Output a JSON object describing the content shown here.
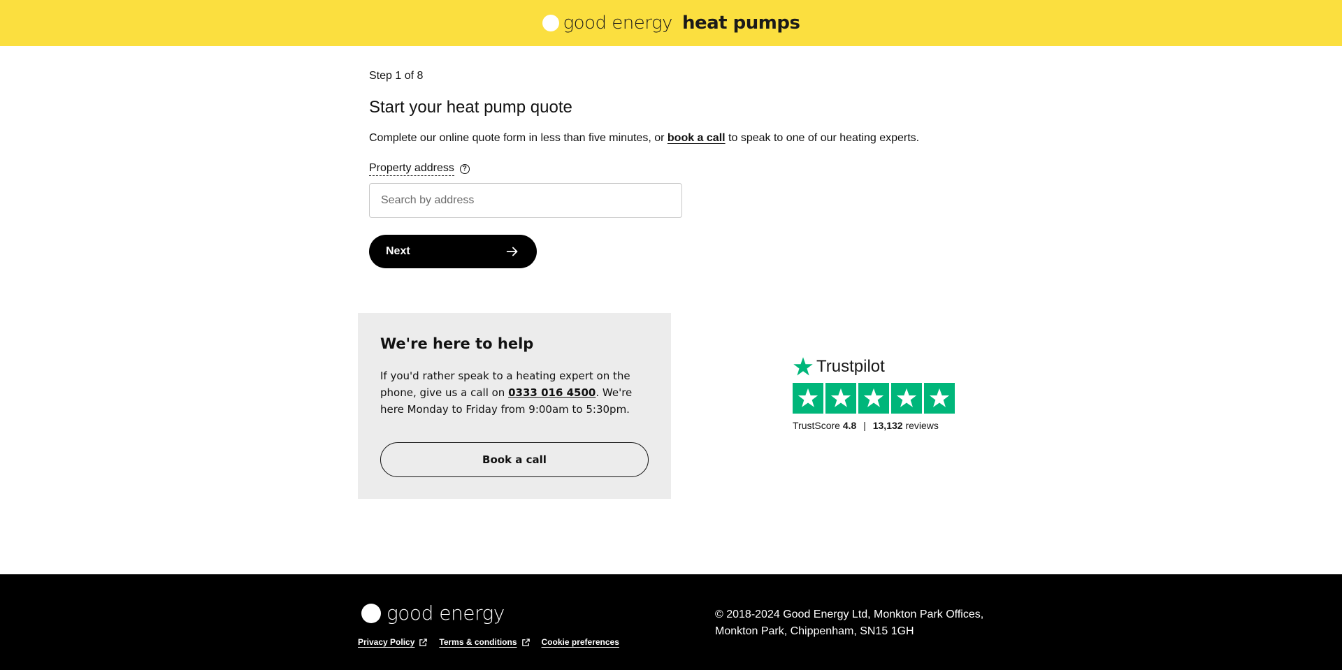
{
  "header": {
    "logo_text_light": "good energy",
    "logo_text_bold": "heat pumps"
  },
  "form": {
    "step": "Step 1 of 8",
    "title": "Start your heat pump quote",
    "intro_before": "Complete our online quote form in less than five minutes, or ",
    "intro_link": "book a call",
    "intro_after": " to speak to one of our heating experts.",
    "address_label": "Property address",
    "address_help_icon": "question-circle-icon",
    "address_placeholder": "Search by address",
    "address_value": "",
    "next_label": "Next",
    "next_icon": "arrow-right-icon"
  },
  "help_card": {
    "title": "We're here to help",
    "text_before": "If you'd rather speak to a heating expert on the phone, give us a call on ",
    "phone": "0333 016 4500",
    "text_after": ". We're here Monday to Friday from 9:00am to 5:30pm.",
    "button_label": "Book a call"
  },
  "trustpilot": {
    "brand": "Trustpilot",
    "stars": 5,
    "score_label": "TrustScore",
    "score_value": "4.8",
    "separator": "|",
    "review_count": "13,132",
    "reviews_label": "reviews",
    "star_color": "#00b67a"
  },
  "footer": {
    "logo_text": "good energy",
    "links": [
      {
        "label": "Privacy Policy",
        "external": true
      },
      {
        "label": "Terms & conditions",
        "external": true
      },
      {
        "label": "Cookie preferences",
        "external": false
      }
    ],
    "address_line1": "© 2018-2024 Good Energy Ltd, Monkton Park Offices,",
    "address_line2": "Monkton Park, Chippenham, SN15 1GH"
  },
  "colors": {
    "brand_yellow": "#fbdf3f",
    "footer_bg": "#000000",
    "card_bg": "#ececec"
  }
}
